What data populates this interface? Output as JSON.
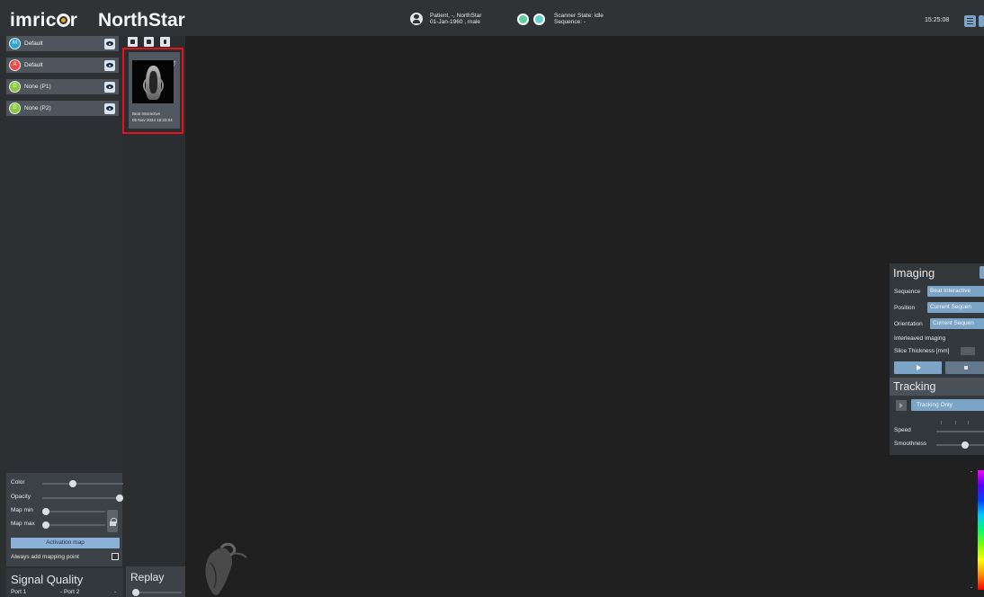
{
  "header": {
    "logo_text": "imric",
    "logo_text_end": "r",
    "product": "NorthStar",
    "patient_line1": "Patient, -, NorthStar",
    "patient_line2": "01-Jan-1960 , male",
    "scanner_line1": "Scanner State: idle",
    "scanner_line2": "Sequence: -",
    "clock": "15:25:08"
  },
  "layers": [
    {
      "badge": "M",
      "label": "Default",
      "color": "#2ca3d8"
    },
    {
      "badge": "A",
      "label": "Default",
      "color": "#e64b4b"
    },
    {
      "badge": "D",
      "label": "None (P1)",
      "color": "#89c73d"
    },
    {
      "badge": "D",
      "label": "None (P2)",
      "color": "#89c73d"
    }
  ],
  "series": {
    "title": "Beat Interactive",
    "timestamp": "05-Nov-2024 15:23:04"
  },
  "display": {
    "color_label": "Color",
    "opacity_label": "Opacity",
    "map_min_label": "Map min",
    "map_max_label": "Map max",
    "activation_button": "Activation map",
    "always_add": "Always add mapping point",
    "color_level": 0.36,
    "opacity_level": 1.0,
    "map_min_level": 0.0,
    "map_max_level": 0.0
  },
  "signal_quality": {
    "title": "Signal Quality",
    "port1": "Port 1",
    "port2": "- Port 2",
    "port2_end": "-"
  },
  "replay": {
    "title": "Replay"
  },
  "imaging": {
    "title": "Imaging",
    "sequence_label": "Sequence",
    "sequence_value": "Beat Interactive",
    "position_label": "Position",
    "position_value": "Current Sequen",
    "orientation_label": "Orientation",
    "orientation_value": "Current Sequen",
    "interleaved_label": "Interleaved Imaging",
    "slice_label": "Slice Thickness [mm]"
  },
  "tracking": {
    "title": "Tracking",
    "mode": "Tracking Only",
    "speed_label": "Speed",
    "smoothness_label": "Smoothness",
    "smoothness_level": 0.62
  },
  "colorbar": {
    "top_label": "-",
    "bottom_label": "-"
  },
  "colors": {
    "accent": "#7ca4c7",
    "highlight_frame": "#e8101a",
    "panel": "#2c2f32"
  }
}
